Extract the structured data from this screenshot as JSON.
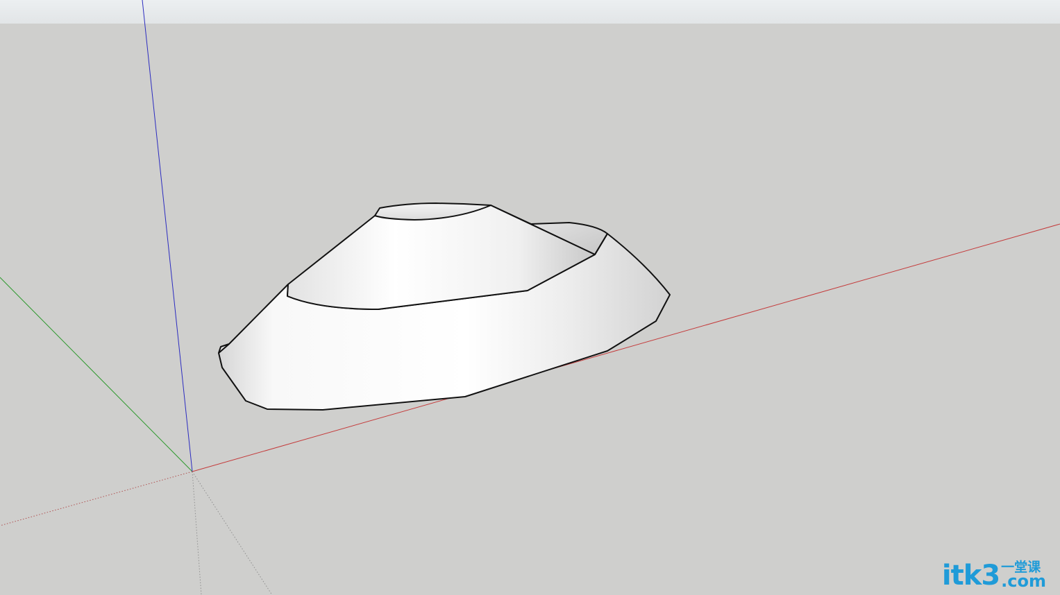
{
  "scene": {
    "background_color": "#cfcfcd",
    "sky_color": "#e6e9eb",
    "axes": {
      "red_axis": {
        "name": "red-axis",
        "color": "#c43a3a"
      },
      "green_axis": {
        "name": "green-axis",
        "color": "#2e9a2e"
      },
      "blue_axis": {
        "name": "blue-axis",
        "color": "#2b2bc0"
      },
      "hidden_axis_color": "#8f8f8f"
    },
    "model": {
      "name": "stepped-cone-solid",
      "face_color": "#ffffff",
      "edge_color": "#111111"
    }
  },
  "watermark": {
    "main": "itk3",
    "chinese": "一堂课",
    "domain": ".com",
    "color": "#1f9bd8"
  }
}
